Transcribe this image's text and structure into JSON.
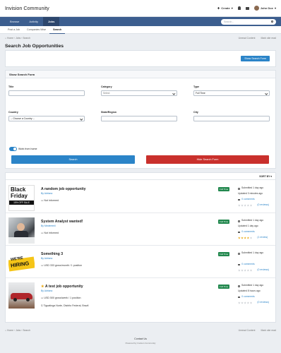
{
  "header": {
    "logo": "Invision Community",
    "create_label": "Create",
    "user_name": "John Doe"
  },
  "nav": {
    "tabs": [
      "Browse",
      "Activity",
      "Jobs"
    ],
    "search_placeholder": "Search..."
  },
  "subnav": {
    "tabs": [
      "Post a Job",
      "Companies Wise",
      "Search"
    ]
  },
  "breadcrumb": {
    "items": [
      "Home",
      "Jobs",
      "Search"
    ],
    "unread": "Unread Content",
    "mark_read": "Mark site read"
  },
  "page": {
    "title": "Search Job Opportunities"
  },
  "show_form_button": "Show Search Form",
  "form": {
    "title": "Show Search Form",
    "title_label": "Title",
    "category_label": "Category",
    "category_value": "Select",
    "type_label": "Type",
    "type_value": "Full Time",
    "country_label": "Country",
    "country_value": "-- Choose a Country --",
    "state_label": "State/Region",
    "city_label": "City",
    "toggle_label": "Work from home",
    "search_button": "Search",
    "hide_button": "Hide Search Form"
  },
  "results": {
    "sort_label": "SORT BY",
    "jobs": [
      {
        "title": "A random job opportunity",
        "by": "By Adriano",
        "meta": "Not informed",
        "location": "",
        "badge": "Full Time",
        "submitted": "Submitted 1 day ago",
        "updated": "Updated 3 minutes ago",
        "comments": "0 comments",
        "rating": 0,
        "reviews": "(0 reviews)"
      },
      {
        "title": "System Analyst wanted!",
        "by": "By Mederemii",
        "meta": "Not informed",
        "location": "",
        "badge": "Full Time",
        "submitted": "Submitted 1 day ago",
        "updated": "Updated 1 day ago",
        "comments": "0 comments",
        "rating": 4,
        "reviews": "(1 review)"
      },
      {
        "title": "Something 3",
        "by": "By Adriano",
        "meta": "USD 333 gross/month / 1 position",
        "location": "",
        "badge": "Full Time",
        "submitted": "Submitted 1 day ago",
        "updated": "",
        "comments": "0 comments",
        "rating": 0,
        "reviews": "(0 reviews)"
      },
      {
        "title": "A test job opportunity",
        "by": "By Adriano",
        "meta": "USD 500 gross/week / 1 position",
        "location": "Tiguatinga Norte, Distrito Federal, Brazil",
        "badge": "Full Time",
        "submitted": "Submitted 1 day ago",
        "updated": "Updated 8 hours ago",
        "comments": "0 comments",
        "rating": 0,
        "reviews": "(0 reviews)"
      }
    ]
  },
  "thumbs": {
    "black_friday": [
      "Black",
      "Friday",
      "15% OFF SALE"
    ],
    "hiring": [
      "WE'RE",
      "HIRING"
    ]
  },
  "footer": {
    "contact": "Contact Us",
    "powered": "Powered by Invision Community"
  },
  "colors": {
    "nav": "#3c5e8f",
    "primary": "#2b84c8",
    "danger": "#c9302c",
    "badge": "#22884e"
  }
}
